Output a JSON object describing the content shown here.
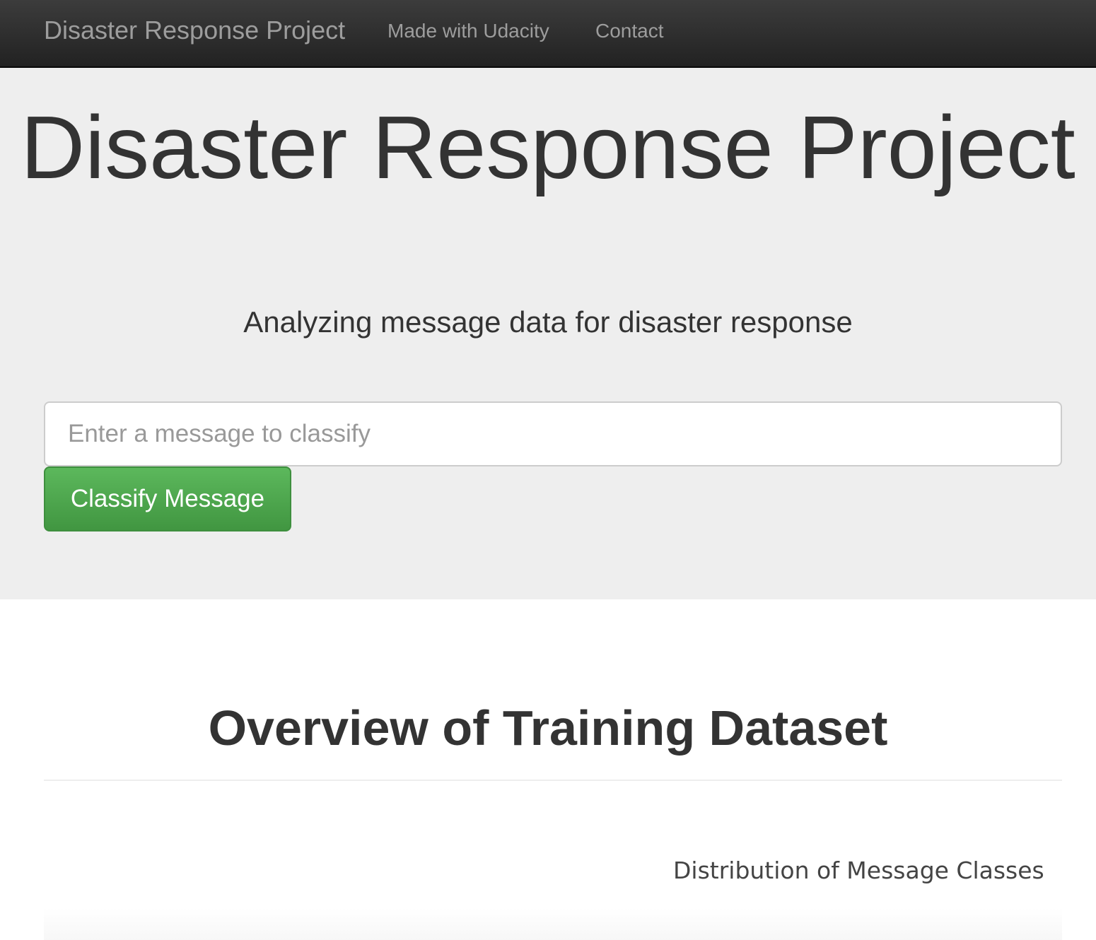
{
  "navbar": {
    "brand": "Disaster Response Project",
    "links": [
      {
        "label": "Made with Udacity"
      },
      {
        "label": "Contact"
      }
    ]
  },
  "hero": {
    "title": "Disaster Response Project",
    "subtitle": "Analyzing message data for disaster response"
  },
  "classify_form": {
    "input_placeholder": "Enter a message to classify",
    "input_value": "",
    "button_label": "Classify Message",
    "button_color": "#5cb85c"
  },
  "overview": {
    "title": "Overview of Training Dataset",
    "chart_title": "Distribution of Message Classes"
  },
  "colors": {
    "navbar_bg": "#222222",
    "jumbotron_bg": "#eeeeee",
    "text": "#333333",
    "nav_text": "#9d9d9d"
  }
}
